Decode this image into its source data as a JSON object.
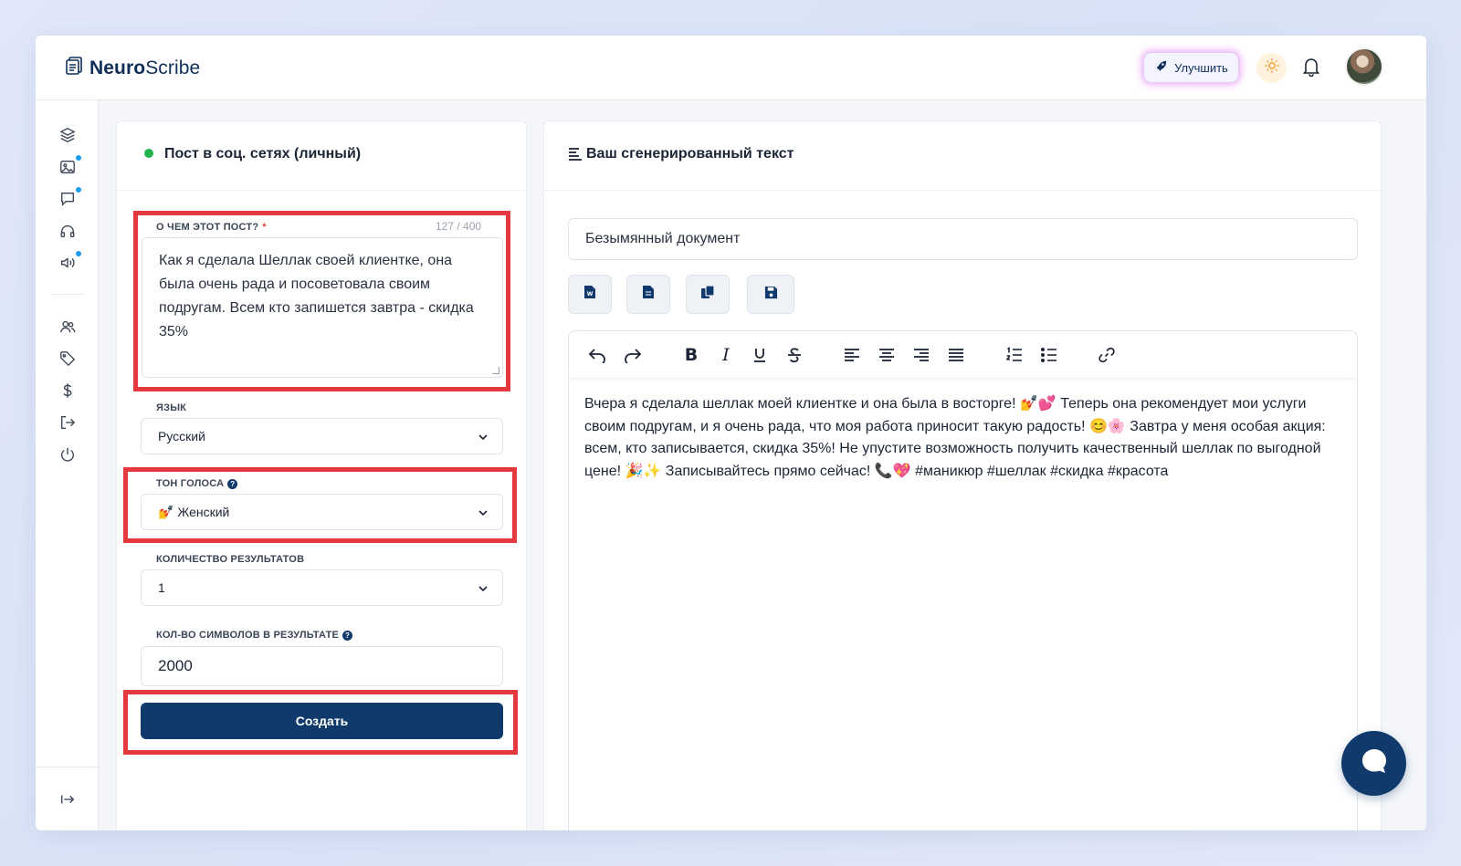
{
  "app": {
    "name_bold": "Neuro",
    "name_regular": "Scribe"
  },
  "header": {
    "upgrade_label": "Улучшить"
  },
  "form": {
    "title": "Пост в соц. сетях (личный)",
    "topic": {
      "label": "О ЧЕМ ЭТОТ ПОСТ?",
      "required_mark": "*",
      "counter": "127 / 400",
      "value": "Как я сделала Шеллак своей клиентке, она была очень рада и посоветовала своим подругам. Всем кто запишется завтра - скидка 35%"
    },
    "language": {
      "label": "ЯЗЫК",
      "value": "Русский"
    },
    "tone": {
      "label": "ТОН ГОЛОСА",
      "value": "💅 Женский"
    },
    "results_count": {
      "label": "КОЛИЧЕСТВО РЕЗУЛЬТАТОВ",
      "value": "1"
    },
    "char_count": {
      "label": "КОЛ-ВО СИМВОЛОВ В РЕЗУЛЬТАТЕ",
      "value": "2000"
    },
    "submit_label": "Создать"
  },
  "output": {
    "title": "Ваш сгенерированный текст",
    "document_name": "Безымянный документ",
    "text": "Вчера я сделала шеллак моей клиентке и она была в восторге! 💅💕 Теперь она рекомендует мои услуги своим подругам, и я очень рада, что моя работа приносит такую радость! 😊🌸 Завтра у меня особая акция: всем, кто записывается, скидка 35%! Не упустите возможность получить качественный шеллак по выгодной цене! 🎉✨ Записывайтесь прямо сейчас! 📞💖 #маникюр #шеллак #скидка #красота"
  },
  "colors": {
    "brand": "#0f3a6b",
    "highlight": "#e4393f",
    "status": "#22b14c",
    "notification_dot": "#1c9cf0"
  }
}
